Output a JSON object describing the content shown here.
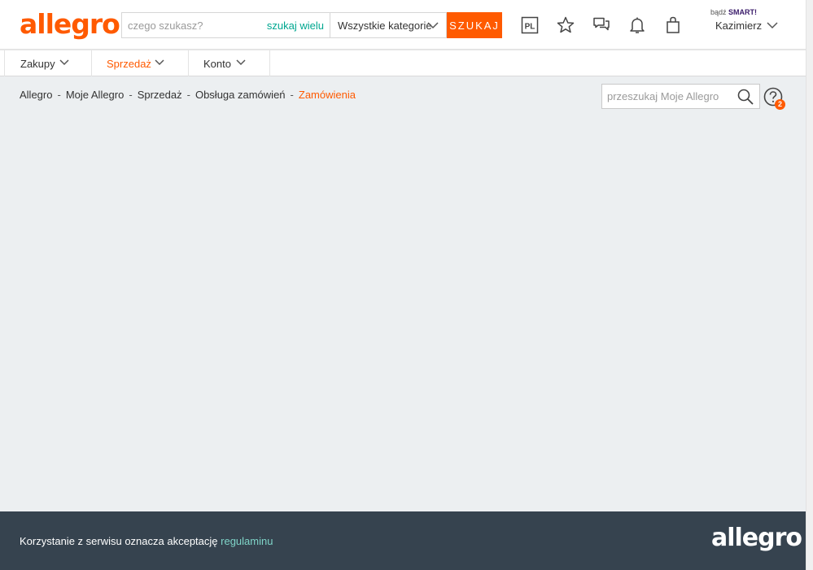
{
  "header": {
    "logo": "allegro",
    "search_placeholder": "czego szukasz?",
    "search_many": "szukaj wielu",
    "category": "Wszystkie kategorie",
    "search_button": "SZUKAJ",
    "lang_badge": "PL",
    "smart_prefix": "bądź",
    "smart_brand": "SMART!",
    "user_name": "Kazimierz"
  },
  "nav": {
    "items": [
      {
        "label": "Zakupy"
      },
      {
        "label": "Sprzedaż"
      },
      {
        "label": "Konto"
      }
    ],
    "active": "Sprzedaż"
  },
  "breadcrumb": {
    "items": [
      "Allegro",
      "Moje Allegro",
      "Sprzedaż",
      "Obsługa zamówień"
    ],
    "current": "Zamówienia",
    "separator": "-"
  },
  "my_search": {
    "placeholder": "przeszukaj Moje Allegro"
  },
  "help": {
    "badge_count": "2"
  },
  "footer": {
    "text": "Korzystanie z serwisu oznacza akceptację",
    "link": "regulaminu",
    "logo": "allegro"
  },
  "colors": {
    "accent": "#ff5a00",
    "link": "#00a790",
    "footer_bg": "#36434f",
    "page_bg": "#eceff1"
  }
}
